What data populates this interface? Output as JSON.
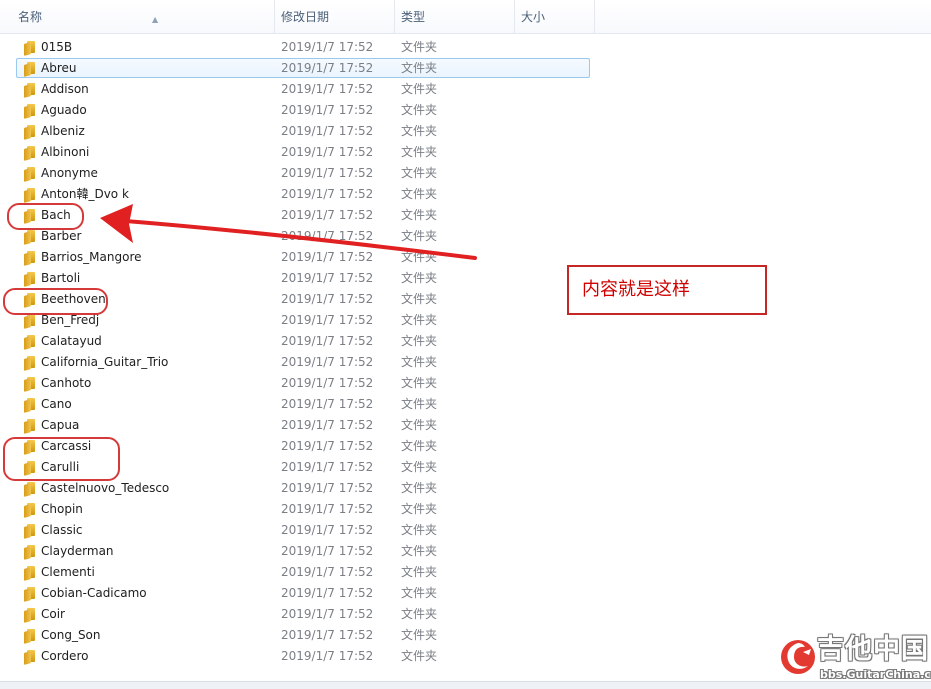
{
  "columns": {
    "name": "名称",
    "date_modified": "修改日期",
    "type": "类型",
    "size": "大小"
  },
  "files": [
    {
      "name": "015B",
      "date": "2019/1/7 17:52",
      "type": "文件夹"
    },
    {
      "name": "Abreu",
      "date": "2019/1/7 17:52",
      "type": "文件夹",
      "selected": true
    },
    {
      "name": "Addison",
      "date": "2019/1/7 17:52",
      "type": "文件夹"
    },
    {
      "name": "Aguado",
      "date": "2019/1/7 17:52",
      "type": "文件夹"
    },
    {
      "name": "Albeniz",
      "date": "2019/1/7 17:52",
      "type": "文件夹"
    },
    {
      "name": "Albinoni",
      "date": "2019/1/7 17:52",
      "type": "文件夹"
    },
    {
      "name": "Anonyme",
      "date": "2019/1/7 17:52",
      "type": "文件夹"
    },
    {
      "name": "Anton韓_Dvo  k",
      "date": "2019/1/7 17:52",
      "type": "文件夹"
    },
    {
      "name": "Bach",
      "date": "2019/1/7 17:52",
      "type": "文件夹"
    },
    {
      "name": "Barber",
      "date": "2019/1/7 17:52",
      "type": "文件夹"
    },
    {
      "name": "Barrios_Mangore",
      "date": "2019/1/7 17:52",
      "type": "文件夹"
    },
    {
      "name": "Bartoli",
      "date": "2019/1/7 17:52",
      "type": "文件夹"
    },
    {
      "name": "Beethoven",
      "date": "2019/1/7 17:52",
      "type": "文件夹"
    },
    {
      "name": "Ben_Fredj",
      "date": "2019/1/7 17:52",
      "type": "文件夹"
    },
    {
      "name": "Calatayud",
      "date": "2019/1/7 17:52",
      "type": "文件夹"
    },
    {
      "name": "California_Guitar_Trio",
      "date": "2019/1/7 17:52",
      "type": "文件夹"
    },
    {
      "name": "Canhoto",
      "date": "2019/1/7 17:52",
      "type": "文件夹"
    },
    {
      "name": "Cano",
      "date": "2019/1/7 17:52",
      "type": "文件夹"
    },
    {
      "name": "Capua",
      "date": "2019/1/7 17:52",
      "type": "文件夹"
    },
    {
      "name": "Carcassi",
      "date": "2019/1/7 17:52",
      "type": "文件夹"
    },
    {
      "name": "Carulli",
      "date": "2019/1/7 17:52",
      "type": "文件夹"
    },
    {
      "name": "Castelnuovo_Tedesco",
      "date": "2019/1/7 17:52",
      "type": "文件夹"
    },
    {
      "name": "Chopin",
      "date": "2019/1/7 17:52",
      "type": "文件夹"
    },
    {
      "name": "Classic",
      "date": "2019/1/7 17:52",
      "type": "文件夹"
    },
    {
      "name": "Clayderman",
      "date": "2019/1/7 17:52",
      "type": "文件夹"
    },
    {
      "name": "Clementi",
      "date": "2019/1/7 17:52",
      "type": "文件夹"
    },
    {
      "name": "Cobian-Cadicamo",
      "date": "2019/1/7 17:52",
      "type": "文件夹"
    },
    {
      "name": "Coir",
      "date": "2019/1/7 17:52",
      "type": "文件夹"
    },
    {
      "name": "Cong_Son",
      "date": "2019/1/7 17:52",
      "type": "文件夹"
    },
    {
      "name": "Cordero",
      "date": "2019/1/7 17:52",
      "type": "文件夹"
    }
  ],
  "annotation": {
    "text": "内容就是这样"
  },
  "watermark": {
    "title": "吉他中国",
    "url": "bbs.GuitarChina.com"
  },
  "colors": {
    "annotation_red": "#d00000",
    "selection_border": "#99c9ef"
  },
  "icons": {
    "folder": "folder-icon",
    "sort": "sort-up-icon",
    "logo": "guitarchina-logo-icon"
  }
}
